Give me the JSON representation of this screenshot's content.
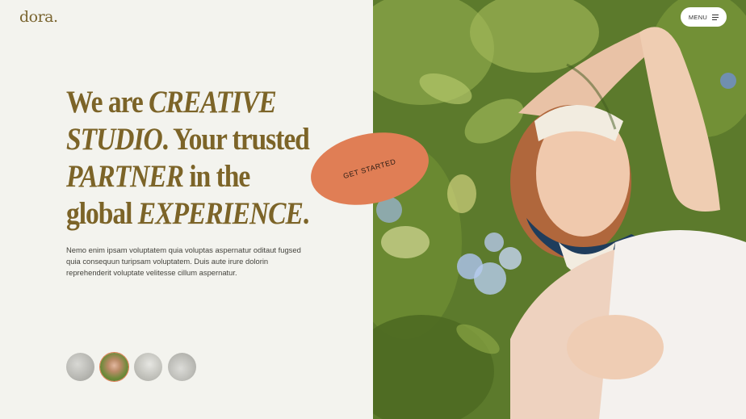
{
  "brand": {
    "logo": "dora."
  },
  "header": {
    "menu_label": "MENU",
    "menu_icon": "hamburger-icon"
  },
  "hero": {
    "line1": {
      "plain": "We are ",
      "italic": "CREATIVE"
    },
    "line2": {
      "italic": "STUDIO",
      "plain": ". Your trusted"
    },
    "line3": {
      "italic": "PARTNER",
      "plain": " in the"
    },
    "line4": {
      "plain": "global ",
      "italic": "EXPERIENCE",
      "tail": "."
    },
    "description": "Nemo enim ipsam voluptatem quia voluptas aspernatur oditaut fugsed quia consequun turipsam voluptatem. Duis aute irure dolorin reprehenderit voluptate velitesse cillum aspernatur.",
    "cta_label": "GET STARTED"
  },
  "thumbnails": [
    {
      "label": "thumbnail-1",
      "active": false
    },
    {
      "label": "thumbnail-2",
      "active": true
    },
    {
      "label": "thumbnail-3",
      "active": false
    },
    {
      "label": "thumbnail-4",
      "active": false
    }
  ],
  "colors": {
    "background": "#f3f3ee",
    "headline": "#7c6428",
    "accent": "#e07e55",
    "foliage": "#5f7e2e"
  }
}
